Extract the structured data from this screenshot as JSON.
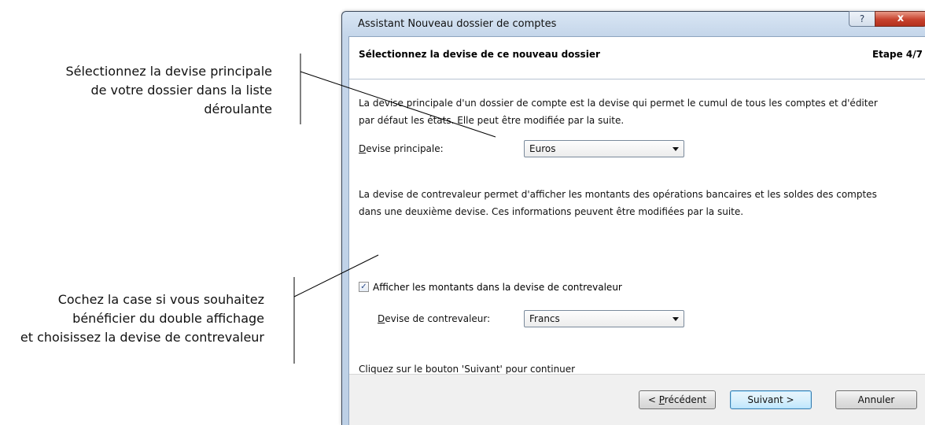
{
  "annotations": {
    "top": [
      "Sélectionnez la devise principale",
      "de votre dossier dans la liste",
      "déroulante"
    ],
    "bottom": [
      "Cochez la case si vous souhaitez",
      "bénéficier du double affichage",
      "et choisissez la devise de contrevaleur"
    ]
  },
  "window": {
    "title": "Assistant Nouveau dossier de comptes",
    "help_label": "?",
    "close_label": "x"
  },
  "header": {
    "title": "Sélectionnez la devise de ce nouveau dossier",
    "step": "Etape 4/7"
  },
  "main": {
    "intro_line1": "La devise principale d'un dossier de compte est la devise qui permet le cumul de tous les comptes et d'éditer",
    "intro_line2": "par défaut les états. Elle peut être modifiée par la suite.",
    "main_currency": {
      "label_first": "D",
      "label_rest": "evise principale:",
      "value": "Euros"
    },
    "countervalue_line1": "La devise de contrevaleur permet d'afficher les montants des opérations bancaires et les soldes des comptes",
    "countervalue_line2": "dans une deuxième devise. Ces informations peuvent être modifiées par la suite.",
    "checkbox": {
      "checked": true,
      "mark": "✓",
      "label": "Afficher les montants dans la devise de contrevaleur"
    },
    "countervalue_currency": {
      "label_first": "D",
      "label_rest": "evise de contrevaleur:",
      "value": "Francs"
    },
    "continue_text": "Cliquez sur le bouton 'Suivant' pour continuer"
  },
  "footer": {
    "prev": {
      "before": "< ",
      "accel": "P",
      "after": "récédent"
    },
    "next_label": "Suivant >",
    "cancel_label": "Annuler"
  }
}
